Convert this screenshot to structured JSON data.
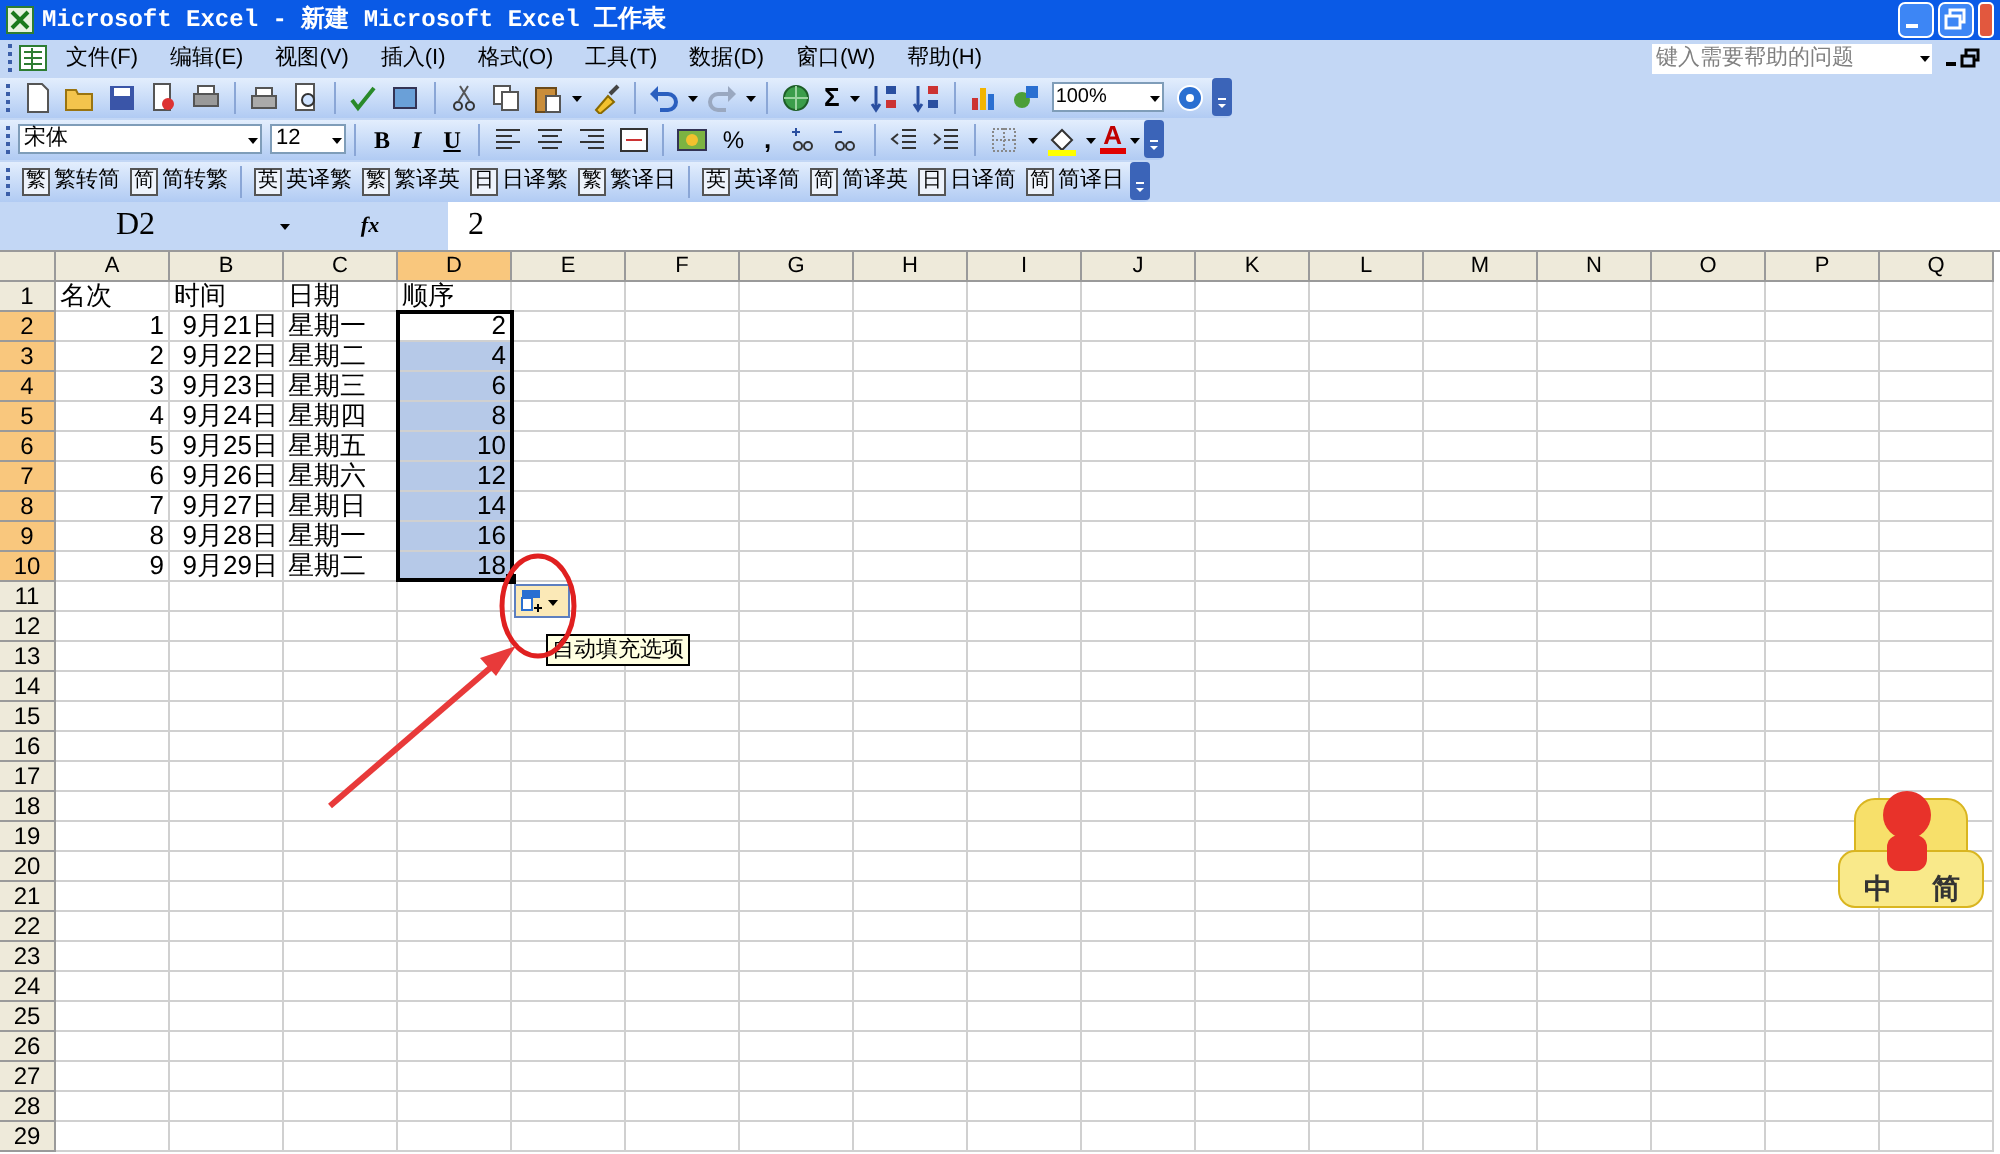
{
  "window": {
    "title": "Microsoft Excel - 新建 Microsoft Excel 工作表"
  },
  "menu": [
    "文件(F)",
    "编辑(E)",
    "视图(V)",
    "插入(I)",
    "格式(O)",
    "工具(T)",
    "数据(D)",
    "窗口(W)",
    "帮助(H)"
  ],
  "help_box": {
    "placeholder": "键入需要帮助的问题"
  },
  "standard_toolbar": {
    "sum": "Σ",
    "zoom": "100%"
  },
  "format_toolbar": {
    "font": "宋体",
    "size": "12",
    "bold": "B",
    "italic": "I",
    "underline": "U",
    "percent": "%",
    "comma": ",",
    "font_color": "A"
  },
  "translate_toolbar": [
    [
      {
        "badge": "繁",
        "label": "繁转简"
      },
      {
        "badge": "简",
        "label": "简转繁"
      }
    ],
    [
      {
        "badge": "英",
        "label": "英译繁"
      },
      {
        "badge": "繁",
        "label": "繁译英"
      },
      {
        "badge": "日",
        "label": "日译繁"
      },
      {
        "badge": "繁",
        "label": "繁译日"
      }
    ],
    [
      {
        "badge": "英",
        "label": "英译简"
      },
      {
        "badge": "简",
        "label": "简译英"
      },
      {
        "badge": "日",
        "label": "日译简"
      },
      {
        "badge": "简",
        "label": "简译日"
      }
    ]
  ],
  "formula_bar": {
    "name_box": "D2",
    "fx": "fx",
    "value": "2"
  },
  "columns": [
    {
      "label": "A",
      "selected": false
    },
    {
      "label": "B",
      "selected": false
    },
    {
      "label": "C",
      "selected": false
    },
    {
      "label": "D",
      "selected": true
    },
    {
      "label": "E",
      "selected": false
    },
    {
      "label": "F",
      "selected": false
    },
    {
      "label": "G",
      "selected": false
    },
    {
      "label": "H",
      "selected": false
    },
    {
      "label": "I",
      "selected": false
    },
    {
      "label": "J",
      "selected": false
    },
    {
      "label": "K",
      "selected": false
    },
    {
      "label": "L",
      "selected": false
    },
    {
      "label": "M",
      "selected": false
    },
    {
      "label": "N",
      "selected": false
    },
    {
      "label": "O",
      "selected": false
    },
    {
      "label": "P",
      "selected": false
    },
    {
      "label": "Q",
      "selected": false
    }
  ],
  "rows": [
    {
      "label": "1",
      "selected": false,
      "cells": [
        {
          "text": "名次",
          "kind": "text",
          "selected": false
        },
        {
          "text": "时间",
          "kind": "text",
          "selected": false
        },
        {
          "text": "日期",
          "kind": "text",
          "selected": false
        },
        {
          "text": "顺序",
          "kind": "text",
          "selected": false
        }
      ]
    },
    {
      "label": "2",
      "selected": true,
      "cells": [
        {
          "text": "1",
          "kind": "number",
          "selected": false
        },
        {
          "text": "9月21日",
          "kind": "number",
          "selected": false
        },
        {
          "text": "星期一",
          "kind": "text",
          "selected": false
        },
        {
          "text": "2",
          "kind": "number",
          "selected": false
        }
      ]
    },
    {
      "label": "3",
      "selected": true,
      "cells": [
        {
          "text": "2",
          "kind": "number",
          "selected": false
        },
        {
          "text": "9月22日",
          "kind": "number",
          "selected": false
        },
        {
          "text": "星期二",
          "kind": "text",
          "selected": false
        },
        {
          "text": "4",
          "kind": "number",
          "selected": true
        }
      ]
    },
    {
      "label": "4",
      "selected": true,
      "cells": [
        {
          "text": "3",
          "kind": "number",
          "selected": false
        },
        {
          "text": "9月23日",
          "kind": "number",
          "selected": false
        },
        {
          "text": "星期三",
          "kind": "text",
          "selected": false
        },
        {
          "text": "6",
          "kind": "number",
          "selected": true
        }
      ]
    },
    {
      "label": "5",
      "selected": true,
      "cells": [
        {
          "text": "4",
          "kind": "number",
          "selected": false
        },
        {
          "text": "9月24日",
          "kind": "number",
          "selected": false
        },
        {
          "text": "星期四",
          "kind": "text",
          "selected": false
        },
        {
          "text": "8",
          "kind": "number",
          "selected": true
        }
      ]
    },
    {
      "label": "6",
      "selected": true,
      "cells": [
        {
          "text": "5",
          "kind": "number",
          "selected": false
        },
        {
          "text": "9月25日",
          "kind": "number",
          "selected": false
        },
        {
          "text": "星期五",
          "kind": "text",
          "selected": false
        },
        {
          "text": "10",
          "kind": "number",
          "selected": true
        }
      ]
    },
    {
      "label": "7",
      "selected": true,
      "cells": [
        {
          "text": "6",
          "kind": "number",
          "selected": false
        },
        {
          "text": "9月26日",
          "kind": "number",
          "selected": false
        },
        {
          "text": "星期六",
          "kind": "text",
          "selected": false
        },
        {
          "text": "12",
          "kind": "number",
          "selected": true
        }
      ]
    },
    {
      "label": "8",
      "selected": true,
      "cells": [
        {
          "text": "7",
          "kind": "number",
          "selected": false
        },
        {
          "text": "9月27日",
          "kind": "number",
          "selected": false
        },
        {
          "text": "星期日",
          "kind": "text",
          "selected": false
        },
        {
          "text": "14",
          "kind": "number",
          "selected": true
        }
      ]
    },
    {
      "label": "9",
      "selected": true,
      "cells": [
        {
          "text": "8",
          "kind": "number",
          "selected": false
        },
        {
          "text": "9月28日",
          "kind": "number",
          "selected": false
        },
        {
          "text": "星期一",
          "kind": "text",
          "selected": false
        },
        {
          "text": "16",
          "kind": "number",
          "selected": true
        }
      ]
    },
    {
      "label": "10",
      "selected": true,
      "cells": [
        {
          "text": "9",
          "kind": "number",
          "selected": false
        },
        {
          "text": "9月29日",
          "kind": "number",
          "selected": false
        },
        {
          "text": "星期二",
          "kind": "text",
          "selected": false
        },
        {
          "text": "18",
          "kind": "number",
          "selected": true
        }
      ]
    },
    {
      "label": "11",
      "selected": false
    },
    {
      "label": "12",
      "selected": false
    },
    {
      "label": "13",
      "selected": false
    },
    {
      "label": "14",
      "selected": false
    },
    {
      "label": "15",
      "selected": false
    },
    {
      "label": "16",
      "selected": false
    },
    {
      "label": "17",
      "selected": false
    },
    {
      "label": "18",
      "selected": false
    },
    {
      "label": "19",
      "selected": false
    },
    {
      "label": "20",
      "selected": false
    },
    {
      "label": "21",
      "selected": false
    },
    {
      "label": "22",
      "selected": false
    },
    {
      "label": "23",
      "selected": false
    },
    {
      "label": "24",
      "selected": false
    },
    {
      "label": "25",
      "selected": false
    },
    {
      "label": "26",
      "selected": false
    },
    {
      "label": "27",
      "selected": false
    },
    {
      "label": "28",
      "selected": false
    },
    {
      "label": "29",
      "selected": false
    }
  ],
  "autofill_tooltip": "自动填充选项",
  "ime_widget": {
    "labels": [
      "中",
      "简"
    ]
  }
}
